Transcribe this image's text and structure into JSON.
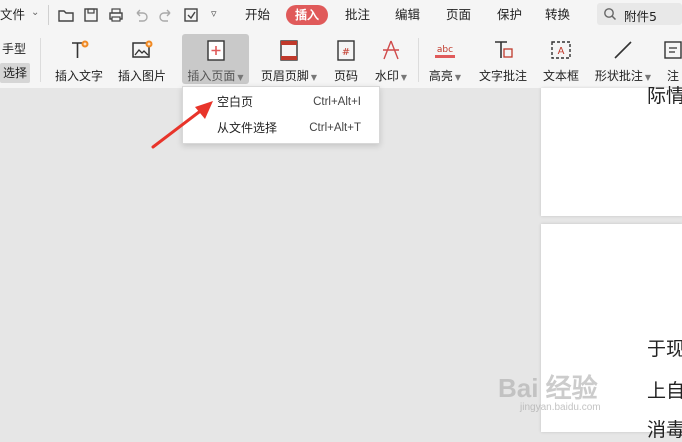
{
  "menubar": {
    "file": "文件",
    "tabs": [
      "开始",
      "插入",
      "批注",
      "编辑",
      "页面",
      "保护",
      "转换"
    ],
    "search_value": "附件5"
  },
  "ribbon": {
    "left_tool_top": "手型",
    "left_tool_bottom": "选择",
    "buttons": {
      "insert_text": "插入文字",
      "insert_image": "插入图片",
      "insert_page": "插入页面",
      "header_footer": "页眉页脚",
      "page_number": "页码",
      "watermark": "水印",
      "highlight": "高亮",
      "text_comment": "文字批注",
      "text_box": "文本框",
      "shape_comment": "形状批注",
      "note": "注"
    }
  },
  "dropdown": {
    "items": [
      {
        "label": "空白页",
        "shortcut": "Ctrl+Alt+I"
      },
      {
        "label": "从文件选择",
        "shortcut": "Ctrl+Alt+T"
      }
    ]
  },
  "document": {
    "page1_line": "际情",
    "page2_lines": [
      "于现",
      "上自",
      "消毒"
    ]
  },
  "overlay": {
    "watermark": "Bai 经验",
    "watermark_sub": "jingyan.baidu.com"
  },
  "colors": {
    "accent": "#e05a5a",
    "arrow": "#e8342a",
    "ribbon_bg": "#f5f5f5",
    "doc_bg": "#e6e6e6"
  }
}
